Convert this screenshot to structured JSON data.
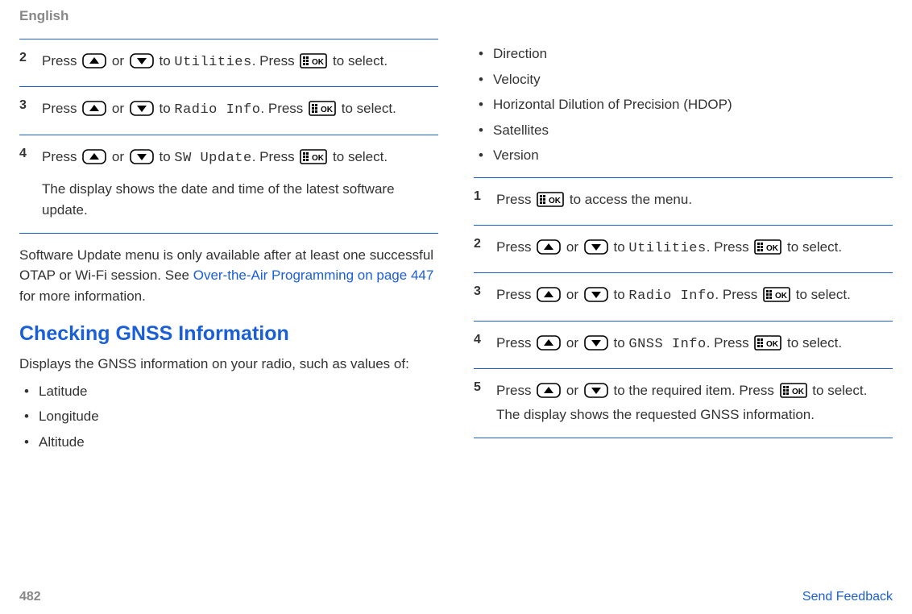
{
  "header": {
    "language": "English"
  },
  "left": {
    "steps": [
      {
        "num": "2",
        "parts": [
          {
            "t": "text",
            "v": "Press "
          },
          {
            "t": "icon",
            "v": "up"
          },
          {
            "t": "text",
            "v": " or "
          },
          {
            "t": "icon",
            "v": "down"
          },
          {
            "t": "text",
            "v": " to "
          },
          {
            "t": "mono",
            "v": "Utilities"
          },
          {
            "t": "text",
            "v": ". Press "
          },
          {
            "t": "icon",
            "v": "ok"
          },
          {
            "t": "text",
            "v": " to select."
          }
        ]
      },
      {
        "num": "3",
        "parts": [
          {
            "t": "text",
            "v": "Press "
          },
          {
            "t": "icon",
            "v": "up"
          },
          {
            "t": "text",
            "v": " or "
          },
          {
            "t": "icon",
            "v": "down"
          },
          {
            "t": "text",
            "v": " to "
          },
          {
            "t": "mono",
            "v": "Radio Info"
          },
          {
            "t": "text",
            "v": ". Press "
          },
          {
            "t": "icon",
            "v": "ok"
          },
          {
            "t": "text",
            "v": " to select."
          }
        ]
      },
      {
        "num": "4",
        "parts": [
          {
            "t": "text",
            "v": "Press "
          },
          {
            "t": "icon",
            "v": "up"
          },
          {
            "t": "text",
            "v": " or "
          },
          {
            "t": "icon",
            "v": "down"
          },
          {
            "t": "text",
            "v": " to "
          },
          {
            "t": "mono",
            "v": "SW Update"
          },
          {
            "t": "text",
            "v": ". Press "
          },
          {
            "t": "icon",
            "v": "ok"
          },
          {
            "t": "text",
            "v": " to select."
          }
        ],
        "extra": "The display shows the date and time of the latest software update."
      }
    ],
    "note_pre": "Software Update menu is only available after at least one successful OTAP or Wi-Fi session. See ",
    "note_link": "Over-the-Air Programming on page 447",
    "note_post": " for more information.",
    "section_title": "Checking GNSS Information",
    "section_intro": "Displays the GNSS information on your radio, such as values of:",
    "bullets": [
      "Latitude",
      "Longitude",
      "Altitude"
    ]
  },
  "right": {
    "bullets": [
      "Direction",
      "Velocity",
      "Horizontal Dilution of Precision (HDOP)",
      "Satellites",
      "Version"
    ],
    "steps": [
      {
        "num": "1",
        "parts": [
          {
            "t": "text",
            "v": "Press "
          },
          {
            "t": "icon",
            "v": "ok"
          },
          {
            "t": "text",
            "v": " to access the menu."
          }
        ]
      },
      {
        "num": "2",
        "parts": [
          {
            "t": "text",
            "v": "Press "
          },
          {
            "t": "icon",
            "v": "up"
          },
          {
            "t": "text",
            "v": " or "
          },
          {
            "t": "icon",
            "v": "down"
          },
          {
            "t": "text",
            "v": " to "
          },
          {
            "t": "mono",
            "v": "Utilities"
          },
          {
            "t": "text",
            "v": ". Press "
          },
          {
            "t": "icon",
            "v": "ok"
          },
          {
            "t": "text",
            "v": " to select."
          }
        ]
      },
      {
        "num": "3",
        "parts": [
          {
            "t": "text",
            "v": "Press "
          },
          {
            "t": "icon",
            "v": "up"
          },
          {
            "t": "text",
            "v": " or "
          },
          {
            "t": "icon",
            "v": "down"
          },
          {
            "t": "text",
            "v": " to "
          },
          {
            "t": "mono",
            "v": "Radio Info"
          },
          {
            "t": "text",
            "v": ". Press "
          },
          {
            "t": "icon",
            "v": "ok"
          },
          {
            "t": "text",
            "v": " to select."
          }
        ]
      },
      {
        "num": "4",
        "parts": [
          {
            "t": "text",
            "v": "Press "
          },
          {
            "t": "icon",
            "v": "up"
          },
          {
            "t": "text",
            "v": " or "
          },
          {
            "t": "icon",
            "v": "down"
          },
          {
            "t": "text",
            "v": " to "
          },
          {
            "t": "mono",
            "v": "GNSS Info"
          },
          {
            "t": "text",
            "v": ". Press "
          },
          {
            "t": "icon",
            "v": "ok"
          },
          {
            "t": "text",
            "v": " to select."
          }
        ]
      },
      {
        "num": "5",
        "parts": [
          {
            "t": "text",
            "v": "Press "
          },
          {
            "t": "icon",
            "v": "up"
          },
          {
            "t": "text",
            "v": " or "
          },
          {
            "t": "icon",
            "v": "down"
          },
          {
            "t": "text",
            "v": " to the required item. Press "
          },
          {
            "t": "icon",
            "v": "ok"
          },
          {
            "t": "text",
            "v": " to select. The display shows the requested GNSS information."
          }
        ]
      }
    ]
  },
  "footer": {
    "page": "482",
    "feedback": "Send Feedback"
  }
}
